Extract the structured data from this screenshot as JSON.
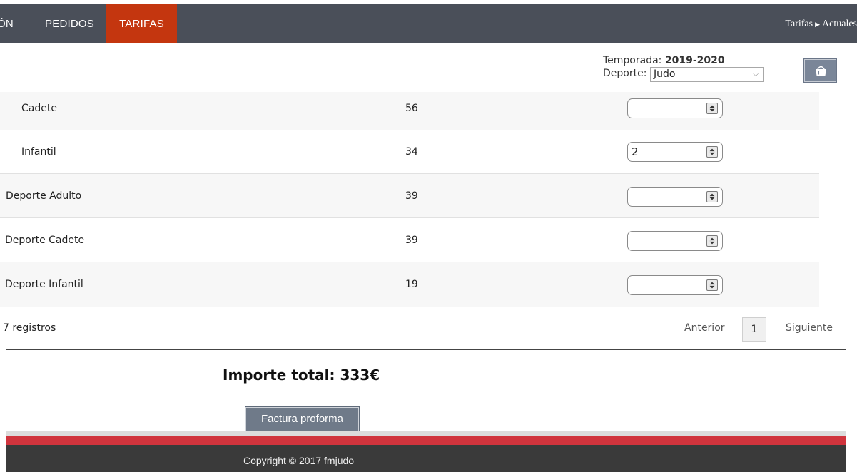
{
  "nav": {
    "items": [
      {
        "label": "ÓN",
        "active": false
      },
      {
        "label": "PEDIDOS",
        "active": false
      },
      {
        "label": "TARIFAS",
        "active": true
      }
    ],
    "breadcrumb": {
      "section": "Tarifas",
      "current": "Actuales"
    }
  },
  "filters": {
    "season_label": "Temporada:",
    "season_value": "2019-2020",
    "sport_label": "Deporte:",
    "sport_value": "Judo"
  },
  "cart_icon": "basket-icon",
  "table": {
    "rows": [
      {
        "name": "Cadete",
        "value": "56",
        "quantity": ""
      },
      {
        "name": "Infantil",
        "value": "34",
        "quantity": "2"
      },
      {
        "name": "Deporte Adulto",
        "value": "39",
        "quantity": ""
      },
      {
        "name": "Deporte Cadete",
        "value": "39",
        "quantity": ""
      },
      {
        "name": "Deporte Infantil",
        "value": "19",
        "quantity": ""
      }
    ]
  },
  "pagination": {
    "count_text": "7 registros",
    "prev_label": "Anterior",
    "current_page": "1",
    "next_label": "Siguiente"
  },
  "summary": {
    "total_text": "Importe total: 333€",
    "proforma_label": "Factura proforma"
  },
  "footer": {
    "copyright": "Copyright © 2017 fmjudo"
  },
  "colors": {
    "topbar": "#4a4f59",
    "active_tab": "#c4360f",
    "button": "#6f7a89",
    "footer_red": "#d0343d",
    "footer_dark": "#3a3a3a"
  }
}
